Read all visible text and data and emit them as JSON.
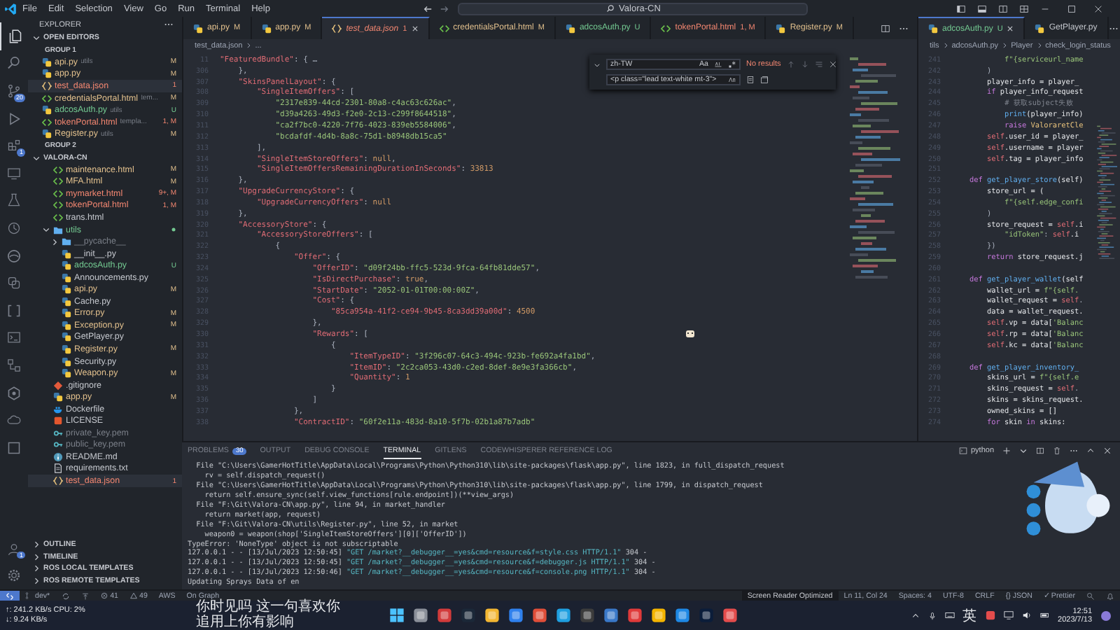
{
  "title_bar": {
    "menu": [
      "File",
      "Edit",
      "Selection",
      "View",
      "Go",
      "Run",
      "Terminal",
      "Help"
    ],
    "search": "Valora-CN"
  },
  "activity_bar": {
    "items": [
      {
        "kind": "explorer",
        "selected": true
      },
      {
        "kind": "search",
        "selected": false
      },
      {
        "kind": "source-control",
        "selected": false,
        "badge": "20"
      },
      {
        "kind": "run-debug",
        "selected": false
      },
      {
        "kind": "extensions",
        "selected": false,
        "badge": "1"
      },
      {
        "kind": "remote",
        "selected": false
      },
      {
        "kind": "testing",
        "selected": false
      },
      {
        "kind": "history",
        "selected": false
      },
      {
        "kind": "browser",
        "selected": false
      },
      {
        "kind": "python",
        "selected": false
      },
      {
        "kind": "brackets",
        "selected": false
      },
      {
        "kind": "terminal",
        "selected": false
      },
      {
        "kind": "nodes",
        "selected": false
      },
      {
        "kind": "hexagon",
        "selected": false
      },
      {
        "kind": "cloud",
        "selected": false
      },
      {
        "kind": "square",
        "selected": false
      }
    ],
    "account_badge": "1"
  },
  "sidebar": {
    "title": "EXPLORER",
    "open_editors": {
      "label": "OPEN EDITORS",
      "expanded": true,
      "groups": [
        {
          "label": "GROUP 1",
          "files": [
            {
              "name": "api.py",
              "detail": "utils",
              "badge": "M",
              "color": "#e2c08d",
              "kind": "py",
              "selected": false
            },
            {
              "name": "app.py",
              "badge": "M",
              "color": "#e2c08d",
              "kind": "py",
              "selected": false
            },
            {
              "name": "test_data.json",
              "badge": "1",
              "color": "#f48771",
              "kind": "json",
              "selected": true
            },
            {
              "name": "credentialsPortal.html",
              "detail": "tem...",
              "badge": "M",
              "color": "#e2c08d",
              "kind": "html",
              "selected": false
            },
            {
              "name": "adcosAuth.py",
              "detail": "utils",
              "badge": "U",
              "color": "#73c991",
              "kind": "py",
              "selected": false
            },
            {
              "name": "tokenPortal.html",
              "detail": "templa...",
              "badge": "1, M",
              "color": "#f48771",
              "kind": "html",
              "selected": false
            },
            {
              "name": "Register.py",
              "detail": "utils",
              "badge": "M",
              "color": "#e2c08d",
              "kind": "py",
              "selected": false
            }
          ]
        },
        {
          "label": "GROUP 2"
        }
      ]
    },
    "workspace": {
      "label": "VALORA-CN",
      "expanded": true,
      "items": [
        {
          "name": "maintenance.html",
          "badge": "M",
          "color": "#e2c08d",
          "kind": "html",
          "selected": false
        },
        {
          "name": "MFA.html",
          "badge": "M",
          "color": "#e2c08d",
          "kind": "html",
          "selected": false
        },
        {
          "name": "mymarket.html",
          "badge": "9+, M",
          "color": "#f48771",
          "kind": "html",
          "selected": false
        },
        {
          "name": "tokenPortal.html",
          "badge": "1, M",
          "color": "#f48771",
          "kind": "html",
          "selected": false
        },
        {
          "name": "trans.html",
          "kind": "html",
          "selected": false
        },
        {
          "name": "utils",
          "color": "#73c991",
          "kind": "folder",
          "expanded": true,
          "selected": false,
          "children": [
            {
              "name": "__pycache__",
              "color": "#7a7f88",
              "kind": "folder",
              "expanded": false,
              "selected": false
            },
            {
              "name": "__init__.py",
              "kind": "py",
              "selected": false
            },
            {
              "name": "adcosAuth.py",
              "badge": "U",
              "color": "#73c991",
              "kind": "py",
              "selected": false
            },
            {
              "name": "Announcements.py",
              "kind": "py",
              "selected": false
            },
            {
              "name": "api.py",
              "badge": "M",
              "color": "#e2c08d",
              "kind": "py",
              "selected": false
            },
            {
              "name": "Cache.py",
              "kind": "py",
              "selected": false
            },
            {
              "name": "Error.py",
              "badge": "M",
              "color": "#e2c08d",
              "kind": "py",
              "selected": false
            },
            {
              "name": "Exception.py",
              "badge": "M",
              "color": "#e2c08d",
              "kind": "py",
              "selected": false
            },
            {
              "name": "GetPlayer.py",
              "kind": "py",
              "selected": false
            },
            {
              "name": "Register.py",
              "badge": "M",
              "color": "#e2c08d",
              "kind": "py",
              "selected": false
            },
            {
              "name": "Security.py",
              "kind": "py",
              "selected": false
            },
            {
              "name": "Weapon.py",
              "badge": "M",
              "color": "#e2c08d",
              "kind": "py",
              "selected": false
            }
          ]
        },
        {
          "name": ".gitignore",
          "kind": "git",
          "selected": false
        },
        {
          "name": "app.py",
          "badge": "M",
          "color": "#e2c08d",
          "kind": "py",
          "selected": false
        },
        {
          "name": "Dockerfile",
          "kind": "docker",
          "selected": false
        },
        {
          "name": "LICENSE",
          "kind": "license",
          "selected": false
        },
        {
          "name": "private_key.pem",
          "color": "#7a7f88",
          "kind": "key",
          "selected": false
        },
        {
          "name": "public_key.pem",
          "color": "#7a7f88",
          "kind": "key",
          "selected": false
        },
        {
          "name": "README.md",
          "kind": "md",
          "selected": false
        },
        {
          "name": "requirements.txt",
          "kind": "txt",
          "selected": false
        },
        {
          "name": "test_data.json",
          "badge": "1",
          "color": "#f48771",
          "kind": "json",
          "selected": true
        }
      ]
    },
    "sections": [
      {
        "label": "OUTLINE",
        "expanded": false
      },
      {
        "label": "TIMELINE",
        "expanded": false
      },
      {
        "label": "ROS LOCAL TEMPLATES",
        "expanded": false
      },
      {
        "label": "ROS REMOTE TEMPLATES",
        "expanded": false
      }
    ]
  },
  "editors": [
    {
      "tabs": [
        {
          "name": "api.py",
          "badge": "M",
          "color": "#e2c08d",
          "kind": "py",
          "selected": false
        },
        {
          "name": "app.py",
          "badge": "M",
          "color": "#e2c08d",
          "kind": "py",
          "selected": false
        },
        {
          "name": "test_data.json",
          "badge": "1",
          "color": "#f48771",
          "kind": "json",
          "selected": true
        },
        {
          "name": "credentialsPortal.html",
          "badge": "M",
          "color": "#e2c08d",
          "kind": "html",
          "selected": false
        },
        {
          "name": "adcosAuth.py",
          "badge": "U",
          "color": "#73c991",
          "kind": "py",
          "selected": false
        },
        {
          "name": "tokenPortal.html",
          "badge": "1, M",
          "color": "#f48771",
          "kind": "html",
          "selected": false
        },
        {
          "name": "Register.py",
          "badge": "M",
          "color": "#e2c08d",
          "kind": "py",
          "selected": false
        }
      ],
      "breadcrumb": [
        "test_data.json",
        "..."
      ],
      "find": {
        "query": "zh-TW",
        "case_toggle": "Aa",
        "result": "No results",
        "replace": "<p class=\"lead text-white mt-3\">"
      },
      "lines": [
        {
          "num": "11",
          "tokens": [
            {
              "text": "\"FeaturedBundle\"",
              "kind": "key"
            },
            {
              "text": ": { …",
              "kind": "punct"
            }
          ]
        },
        {
          "num": "306",
          "tokens": [
            {
              "text": "    },",
              "kind": "punct"
            }
          ]
        },
        {
          "num": "307",
          "tokens": [
            {
              "text": "    \"SkinsPanelLayout\"",
              "kind": "key"
            },
            {
              "text": ": {",
              "kind": "punct"
            }
          ]
        },
        {
          "num": "308",
          "tokens": [
            {
              "text": "        \"SingleItemOffers\"",
              "kind": "key"
            },
            {
              "text": ": [",
              "kind": "punct"
            }
          ]
        },
        {
          "num": "309",
          "tokens": [
            {
              "text": "            \"2317e839-44cd-2301-80a8-c4ac63c626ac\"",
              "kind": "string"
            },
            {
              "text": ",",
              "kind": "punct"
            }
          ]
        },
        {
          "num": "310",
          "tokens": [
            {
              "text": "            \"d39a4263-49d3-f2e0-2c13-c299f8644518\"",
              "kind": "string"
            },
            {
              "text": ",",
              "kind": "punct"
            }
          ]
        },
        {
          "num": "311",
          "tokens": [
            {
              "text": "            \"ca2f7bc0-4220-7f76-4023-839eb5584006\"",
              "kind": "string"
            },
            {
              "text": ",",
              "kind": "punct"
            }
          ]
        },
        {
          "num": "312",
          "tokens": [
            {
              "text": "            \"bcdafdf-4d4b-8a8c-75d1-b8948db15ca5\"",
              "kind": "string"
            }
          ]
        },
        {
          "num": "313",
          "tokens": [
            {
              "text": "        ],",
              "kind": "punct"
            }
          ]
        },
        {
          "num": "314",
          "tokens": [
            {
              "text": "        \"SingleItemStoreOffers\"",
              "kind": "key"
            },
            {
              "text": ": ",
              "kind": "punct"
            },
            {
              "text": "null",
              "kind": "literal"
            },
            {
              "text": ",",
              "kind": "punct"
            }
          ]
        },
        {
          "num": "315",
          "tokens": [
            {
              "text": "        \"SingleItemOffersRemainingDurationInSeconds\"",
              "kind": "key"
            },
            {
              "text": ": ",
              "kind": "punct"
            },
            {
              "text": "33813",
              "kind": "number"
            }
          ]
        },
        {
          "num": "316",
          "tokens": [
            {
              "text": "    },",
              "kind": "punct"
            }
          ]
        },
        {
          "num": "317",
          "tokens": [
            {
              "text": "    \"UpgradeCurrencyStore\"",
              "kind": "key"
            },
            {
              "text": ": {",
              "kind": "punct"
            }
          ]
        },
        {
          "num": "318",
          "tokens": [
            {
              "text": "        \"UpgradeCurrencyOffers\"",
              "kind": "key"
            },
            {
              "text": ": ",
              "kind": "punct"
            },
            {
              "text": "null",
              "kind": "literal"
            }
          ]
        },
        {
          "num": "319",
          "tokens": [
            {
              "text": "    },",
              "kind": "punct"
            }
          ]
        },
        {
          "num": "320",
          "tokens": [
            {
              "text": "    \"AccessoryStore\"",
              "kind": "key"
            },
            {
              "text": ": {",
              "kind": "punct"
            }
          ]
        },
        {
          "num": "321",
          "tokens": [
            {
              "text": "        \"AccessoryStoreOffers\"",
              "kind": "key"
            },
            {
              "text": ": [",
              "kind": "punct"
            }
          ]
        },
        {
          "num": "322",
          "tokens": [
            {
              "text": "            {",
              "kind": "punct"
            }
          ]
        },
        {
          "num": "323",
          "tokens": [
            {
              "text": "                \"Offer\"",
              "kind": "key"
            },
            {
              "text": ": {",
              "kind": "punct"
            }
          ]
        },
        {
          "num": "324",
          "tokens": [
            {
              "text": "                    \"OfferID\"",
              "kind": "key"
            },
            {
              "text": ": ",
              "kind": "punct"
            },
            {
              "text": "\"d09f24bb-ffc5-523d-9fca-64fb81dde57\"",
              "kind": "string"
            },
            {
              "text": ",",
              "kind": "punct"
            }
          ]
        },
        {
          "num": "325",
          "tokens": [
            {
              "text": "                    \"IsDirectPurchase\"",
              "kind": "key"
            },
            {
              "text": ": ",
              "kind": "punct"
            },
            {
              "text": "true",
              "kind": "literal"
            },
            {
              "text": ",",
              "kind": "punct"
            }
          ]
        },
        {
          "num": "326",
          "tokens": [
            {
              "text": "                    \"StartDate\"",
              "kind": "key"
            },
            {
              "text": ": ",
              "kind": "punct"
            },
            {
              "text": "\"2052-01-01T00:00:00Z\"",
              "kind": "string"
            },
            {
              "text": ",",
              "kind": "punct"
            }
          ]
        },
        {
          "num": "327",
          "tokens": [
            {
              "text": "                    \"Cost\"",
              "kind": "key"
            },
            {
              "text": ": {",
              "kind": "punct"
            }
          ]
        },
        {
          "num": "328",
          "tokens": [
            {
              "text": "                        \"85ca954a-41f2-ce94-9b45-8ca3dd39a00d\"",
              "kind": "key"
            },
            {
              "text": ": ",
              "kind": "punct"
            },
            {
              "text": "4500",
              "kind": "number"
            }
          ]
        },
        {
          "num": "329",
          "tokens": [
            {
              "text": "                    },",
              "kind": "punct"
            }
          ]
        },
        {
          "num": "330",
          "tokens": [
            {
              "text": "                    \"Rewards\"",
              "kind": "key"
            },
            {
              "text": ": [",
              "kind": "punct"
            }
          ]
        },
        {
          "num": "331",
          "tokens": [
            {
              "text": "                        {",
              "kind": "punct"
            }
          ]
        },
        {
          "num": "332",
          "tokens": [
            {
              "text": "                            \"ItemTypeID\"",
              "kind": "key"
            },
            {
              "text": ": ",
              "kind": "punct"
            },
            {
              "text": "\"3f296c07-64c3-494c-923b-fe692a4fa1bd\"",
              "kind": "string"
            },
            {
              "text": ",",
              "kind": "punct"
            }
          ]
        },
        {
          "num": "333",
          "tokens": [
            {
              "text": "                            \"ItemID\"",
              "kind": "key"
            },
            {
              "text": ": ",
              "kind": "punct"
            },
            {
              "text": "\"2c2ca053-43d0-c2ed-8def-8e9e3fa366cb\"",
              "kind": "string"
            },
            {
              "text": ",",
              "kind": "punct"
            }
          ]
        },
        {
          "num": "334",
          "tokens": [
            {
              "text": "                            \"Quantity\"",
              "kind": "key"
            },
            {
              "text": ": ",
              "kind": "punct"
            },
            {
              "text": "1",
              "kind": "number"
            }
          ]
        },
        {
          "num": "335",
          "tokens": [
            {
              "text": "                        }",
              "kind": "punct"
            }
          ]
        },
        {
          "num": "336",
          "tokens": [
            {
              "text": "                    ]",
              "kind": "punct"
            }
          ]
        },
        {
          "num": "337",
          "tokens": [
            {
              "text": "                },",
              "kind": "punct"
            }
          ]
        },
        {
          "num": "338",
          "tokens": [
            {
              "text": "                \"ContractID\"",
              "kind": "key"
            },
            {
              "text": ": ",
              "kind": "punct"
            },
            {
              "text": "\"60f2e11a-483d-8a10-5f7b-02b1a87b7adb\"",
              "kind": "string"
            }
          ]
        }
      ]
    },
    {
      "tabs": [
        {
          "name": "adcosAuth.py",
          "badge": "U",
          "color": "#73c991",
          "kind": "py",
          "selected": true
        },
        {
          "name": "GetPlayer.py",
          "kind": "py",
          "selected": false
        }
      ],
      "breadcrumb": [
        "tils",
        "adcosAuth.py",
        "Player",
        "check_login_status"
      ],
      "lines": [
        {
          "num": "241",
          "tokens": [
            {
              "text": "            f\"{serviceurl_name",
              "kind": "string"
            }
          ]
        },
        {
          "num": "242",
          "tokens": [
            {
              "text": "        )",
              "kind": "punct"
            }
          ]
        },
        {
          "num": "243",
          "tokens": [
            {
              "text": "        player_info = player_",
              "kind": "variable"
            }
          ]
        },
        {
          "num": "244",
          "tokens": [
            {
              "text": "        if ",
              "kind": "keyword"
            },
            {
              "text": "player_info_request",
              "kind": "variable"
            }
          ]
        },
        {
          "num": "245",
          "tokens": [
            {
              "text": "            # 获取subject失败",
              "kind": "comment"
            }
          ]
        },
        {
          "num": "246",
          "tokens": [
            {
              "text": "            print",
              "kind": "function"
            },
            {
              "text": "(player_info)",
              "kind": "variable"
            }
          ]
        },
        {
          "num": "247",
          "tokens": [
            {
              "text": "            raise ",
              "kind": "keyword"
            },
            {
              "text": "ValoraretCle",
              "kind": "class"
            }
          ]
        },
        {
          "num": "248",
          "tokens": [
            {
              "text": "        self",
              "kind": "self"
            },
            {
              "text": ".user_id = player_",
              "kind": "variable"
            }
          ]
        },
        {
          "num": "249",
          "tokens": [
            {
              "text": "        self",
              "kind": "self"
            },
            {
              "text": ".username = player",
              "kind": "variable"
            }
          ]
        },
        {
          "num": "250",
          "tokens": [
            {
              "text": "        self",
              "kind": "self"
            },
            {
              "text": ".tag = player_info",
              "kind": "variable"
            }
          ]
        },
        {
          "num": "251"
        },
        {
          "num": "252",
          "tokens": [
            {
              "text": "    def ",
              "kind": "keyword"
            },
            {
              "text": "get_player_store",
              "kind": "function"
            },
            {
              "text": "(self)",
              "kind": "variable"
            }
          ]
        },
        {
          "num": "253",
          "tokens": [
            {
              "text": "        store_url = (",
              "kind": "variable"
            }
          ]
        },
        {
          "num": "254",
          "tokens": [
            {
              "text": "            f\"{self.edge_confi",
              "kind": "string"
            }
          ]
        },
        {
          "num": "255",
          "tokens": [
            {
              "text": "        )",
              "kind": "punct"
            }
          ]
        },
        {
          "num": "256",
          "tokens": [
            {
              "text": "        store_request = ",
              "kind": "variable"
            },
            {
              "text": "self",
              "kind": "self"
            },
            {
              "text": ".i",
              "kind": "variable"
            }
          ]
        },
        {
          "num": "257",
          "tokens": [
            {
              "text": "            \"idToken\"",
              "kind": "string"
            },
            {
              "text": ": ",
              "kind": "punct"
            },
            {
              "text": "self",
              "kind": "self"
            },
            {
              "text": ".i",
              "kind": "variable"
            }
          ]
        },
        {
          "num": "258",
          "tokens": [
            {
              "text": "        })",
              "kind": "punct"
            }
          ]
        },
        {
          "num": "259",
          "tokens": [
            {
              "text": "        return ",
              "kind": "keyword"
            },
            {
              "text": "store_request.j",
              "kind": "variable"
            }
          ]
        },
        {
          "num": "260"
        },
        {
          "num": "261",
          "tokens": [
            {
              "text": "    def ",
              "kind": "keyword"
            },
            {
              "text": "get_player_wallet",
              "kind": "function"
            },
            {
              "text": "(self",
              "kind": "variable"
            }
          ]
        },
        {
          "num": "262",
          "tokens": [
            {
              "text": "        wallet_url = ",
              "kind": "variable"
            },
            {
              "text": "f\"{self.",
              "kind": "string"
            }
          ]
        },
        {
          "num": "263",
          "tokens": [
            {
              "text": "        wallet_request = ",
              "kind": "variable"
            },
            {
              "text": "self",
              "kind": "self"
            },
            {
              "text": ".",
              "kind": "punct"
            }
          ]
        },
        {
          "num": "264",
          "tokens": [
            {
              "text": "        data = wallet_request.",
              "kind": "variable"
            }
          ]
        },
        {
          "num": "265",
          "tokens": [
            {
              "text": "        self",
              "kind": "self"
            },
            {
              "text": ".vp = data[",
              "kind": "variable"
            },
            {
              "text": "'Balanc",
              "kind": "string"
            }
          ]
        },
        {
          "num": "266",
          "tokens": [
            {
              "text": "        self",
              "kind": "self"
            },
            {
              "text": ".rp = data[",
              "kind": "variable"
            },
            {
              "text": "'Balanc",
              "kind": "string"
            }
          ]
        },
        {
          "num": "267",
          "tokens": [
            {
              "text": "        self",
              "kind": "self"
            },
            {
              "text": ".kc = data[",
              "kind": "variable"
            },
            {
              "text": "'Balanc",
              "kind": "string"
            }
          ]
        },
        {
          "num": "268"
        },
        {
          "num": "269",
          "tokens": [
            {
              "text": "    def ",
              "kind": "keyword"
            },
            {
              "text": "get_player_inventory_",
              "kind": "function"
            }
          ]
        },
        {
          "num": "270",
          "tokens": [
            {
              "text": "        skins_url = ",
              "kind": "variable"
            },
            {
              "text": "f\"{self.e",
              "kind": "string"
            }
          ]
        },
        {
          "num": "271",
          "tokens": [
            {
              "text": "        skins_request = ",
              "kind": "variable"
            },
            {
              "text": "self",
              "kind": "self"
            },
            {
              "text": ".",
              "kind": "punct"
            }
          ]
        },
        {
          "num": "272",
          "tokens": [
            {
              "text": "        skins = skins_request.",
              "kind": "variable"
            }
          ]
        },
        {
          "num": "273",
          "tokens": [
            {
              "text": "        owned_skins = []",
              "kind": "variable"
            }
          ]
        },
        {
          "num": "274",
          "tokens": [
            {
              "text": "        for ",
              "kind": "keyword"
            },
            {
              "text": "skin ",
              "kind": "variable"
            },
            {
              "text": "in ",
              "kind": "keyword"
            },
            {
              "text": "skins:",
              "kind": "variable"
            }
          ]
        }
      ]
    }
  ],
  "panel": {
    "tabs": [
      {
        "label": "PROBLEMS",
        "badge": "30",
        "selected": false
      },
      {
        "label": "OUTPUT",
        "selected": false
      },
      {
        "label": "DEBUG CONSOLE",
        "selected": false
      },
      {
        "label": "TERMINAL",
        "selected": true
      },
      {
        "label": "GITLENS",
        "selected": false
      },
      {
        "label": "CODEWHISPERER REFERENCE LOG",
        "selected": false
      }
    ],
    "shell": "python",
    "terminal_lines": [
      [
        {
          "text": "  File \"C:\\Users\\GamerHotTitle\\AppData\\Local\\Programs\\Python\\Python310\\lib\\site-packages\\flask\\app.py\", line 1823, in full_dispatch_request",
          "kind": "plain"
        }
      ],
      [
        {
          "text": "    rv = self.dispatch_request()",
          "kind": "plain"
        }
      ],
      [
        {
          "text": "  File \"C:\\Users\\GamerHotTitle\\AppData\\Local\\Programs\\Python\\Python310\\lib\\site-packages\\flask\\app.py\", line 1799, in dispatch_request",
          "kind": "plain"
        }
      ],
      [
        {
          "text": "    return self.ensure_sync(self.view_functions[rule.endpoint])(**view_args)",
          "kind": "plain"
        }
      ],
      [
        {
          "text": "  File \"F:\\Git\\Valora-CN\\app.py\", line 94, in market_handler",
          "kind": "plain"
        }
      ],
      [
        {
          "text": "    return market(app, request)",
          "kind": "plain"
        }
      ],
      [
        {
          "text": "  File \"F:\\Git\\Valora-CN\\utils\\Register.py\", line 52, in market",
          "kind": "plain"
        }
      ],
      [
        {
          "text": "    weapon0 = weapon(shop['SingleItemStoreOffers'][0]['OfferID'])",
          "kind": "plain"
        }
      ],
      [
        {
          "text": "TypeError: 'NoneType' object is not subscriptable",
          "kind": "plain"
        }
      ],
      [
        {
          "text": "127.0.0.1 - - [13/Jul/2023 12:50:45] ",
          "kind": "plain"
        },
        {
          "text": "\"GET /market?__debugger__=yes&cmd=resource&f=style.css HTTP/1.1\"",
          "kind": "request"
        },
        {
          "text": " 304 -",
          "kind": "plain"
        }
      ],
      [
        {
          "text": "127.0.0.1 - - [13/Jul/2023 12:50:45] ",
          "kind": "plain"
        },
        {
          "text": "\"GET /market?__debugger__=yes&cmd=resource&f=debugger.js HTTP/1.1\"",
          "kind": "request"
        },
        {
          "text": " 304 -",
          "kind": "plain"
        }
      ],
      [
        {
          "text": "127.0.0.1 - - [13/Jul/2023 12:50:46] ",
          "kind": "plain"
        },
        {
          "text": "\"GET /market?__debugger__=yes&cmd=resource&f=console.png HTTP/1.1\"",
          "kind": "request"
        },
        {
          "text": " 304 -",
          "kind": "plain"
        }
      ],
      [
        {
          "text": "Updating Sprays Data of en",
          "kind": "plain"
        }
      ]
    ]
  },
  "status_bar": {
    "left": [
      {
        "kind": "remote"
      },
      {
        "kind": "branch",
        "text": "dev*"
      },
      {
        "kind": "sync"
      },
      {
        "kind": "publish"
      },
      {
        "kind": "errors",
        "text": "41"
      },
      {
        "kind": "warnings",
        "text": "49"
      },
      {
        "kind": "plain",
        "text": "AWS"
      },
      {
        "kind": "plain",
        "text": "On Graph"
      }
    ],
    "right": [
      {
        "kind": "highlight",
        "text": "Screen Reader Optimized"
      },
      {
        "kind": "plain",
        "text": "Ln 11, Col 24"
      },
      {
        "kind": "plain",
        "text": "Spaces: 4"
      },
      {
        "kind": "plain",
        "text": "UTF-8"
      },
      {
        "kind": "plain",
        "text": "CRLF"
      },
      {
        "kind": "plain",
        "text": "{} JSON"
      },
      {
        "kind": "plain",
        "text": "✓ Prettier"
      },
      {
        "kind": "feedback"
      },
      {
        "kind": "bell"
      }
    ]
  },
  "taskbar": {
    "stats": [
      "↑: 241.2 KB/s  CPU: 2%",
      "↓: 9.24 KB/s"
    ],
    "message": [
      "你时见吗 这一句喜欢你",
      "追用上你有影响"
    ],
    "ime": "英",
    "time": "12:51",
    "date": "2023/7/13"
  }
}
